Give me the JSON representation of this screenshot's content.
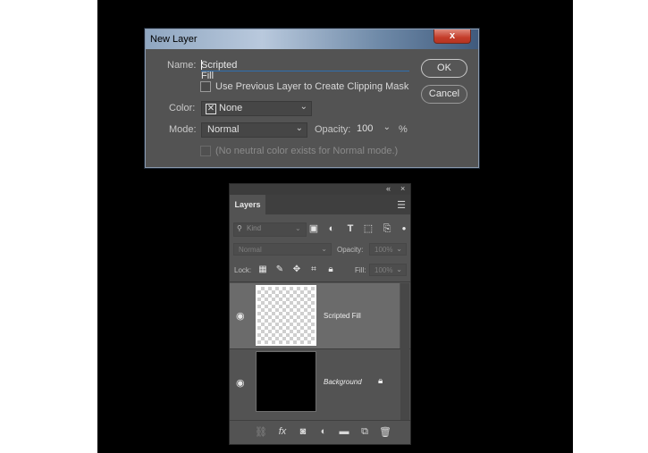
{
  "dialog": {
    "title": "New Layer",
    "close_label": "x",
    "name_label": "Name:",
    "name_value": "Scripted Fill",
    "clipping_label": "Use Previous Layer to Create Clipping Mask",
    "color_label": "Color:",
    "color_value": "None",
    "mode_label": "Mode:",
    "mode_value": "Normal",
    "opacity_label": "Opacity:",
    "opacity_value": "100",
    "opacity_unit": "%",
    "neutral_label": "(No neutral color exists for Normal mode.)",
    "ok_label": "OK",
    "cancel_label": "Cancel"
  },
  "panel": {
    "collapse_glyph": "«",
    "close_glyph": "×",
    "tab_label": "Layers",
    "menu_icon": "panel-menu-icon",
    "kind_label": "Kind",
    "blend_mode": "Normal",
    "opacity_label": "Opacity:",
    "opacity_value": "100%",
    "lock_label": "Lock:",
    "fill_label": "Fill:",
    "fill_value": "100%",
    "layers": [
      {
        "name": "Scripted Fill",
        "selected": true,
        "thumb": "transparent"
      },
      {
        "name": "Background",
        "selected": false,
        "thumb": "black",
        "locked": true
      }
    ]
  }
}
